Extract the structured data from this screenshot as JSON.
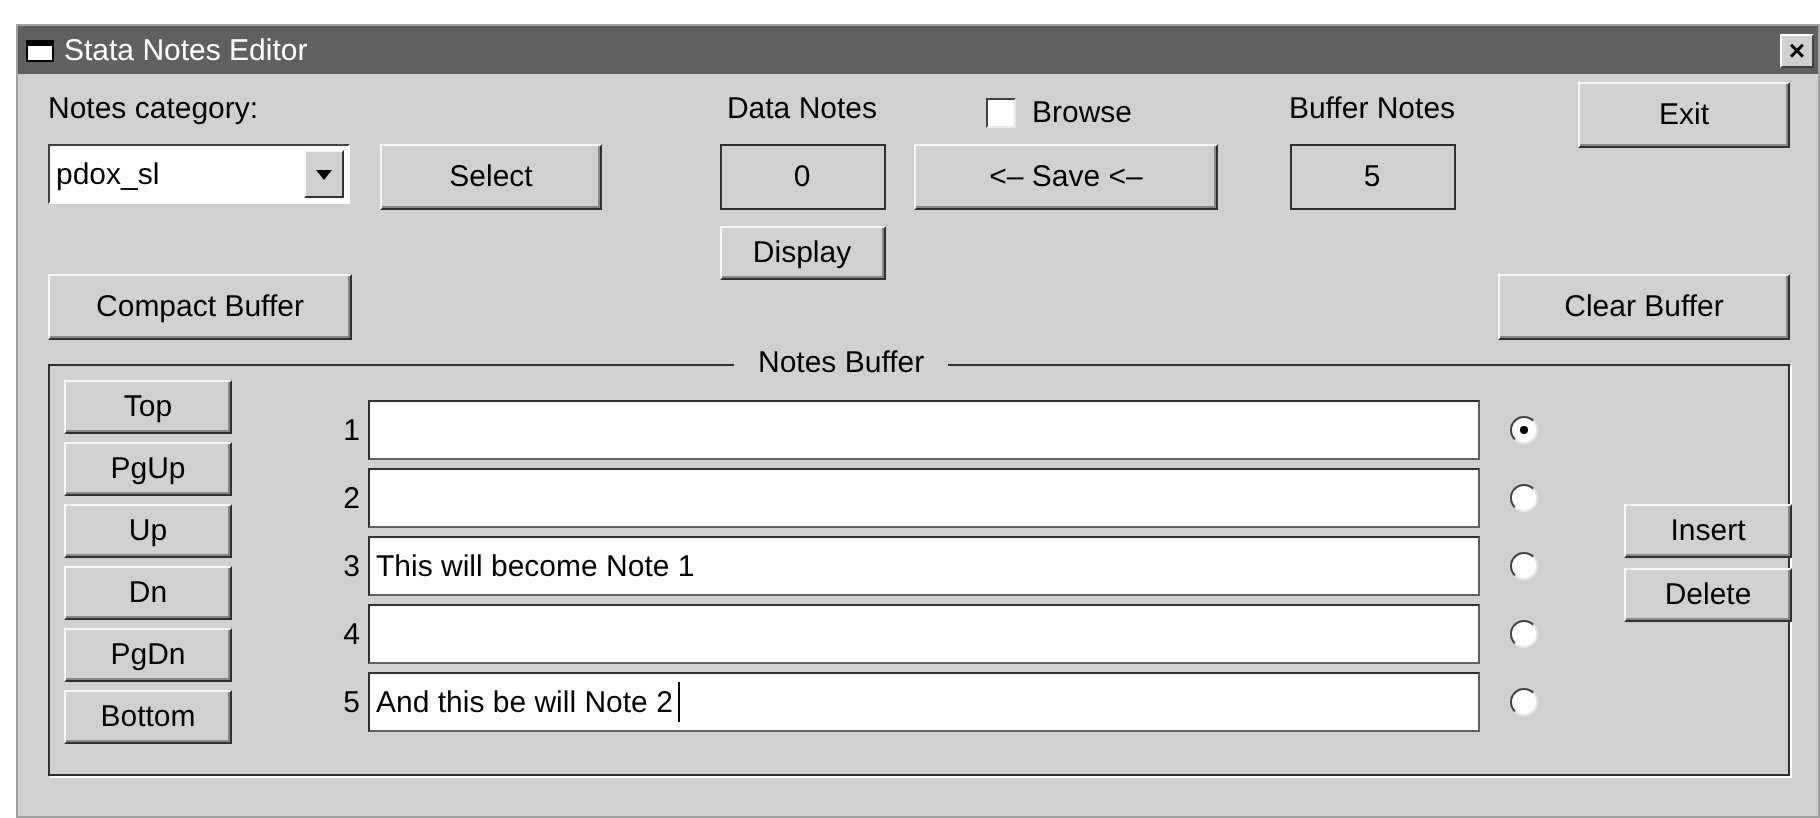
{
  "window": {
    "title": "Stata Notes Editor",
    "close": "×"
  },
  "category": {
    "label": "Notes category:",
    "value": "pdox_sl",
    "select_button": "Select"
  },
  "data_notes": {
    "label": "Data Notes",
    "count": "0",
    "display_button": "Display"
  },
  "browse": {
    "label": "Browse",
    "checked": false
  },
  "save_button": "<– Save <–",
  "buffer_notes": {
    "label": "Buffer Notes",
    "count": "5"
  },
  "exit_button": "Exit",
  "compact_button": "Compact Buffer",
  "clear_button": "Clear Buffer",
  "notes_buffer": {
    "title": "Notes Buffer",
    "nav_buttons": [
      "Top",
      "PgUp",
      "Up",
      "Dn",
      "PgDn",
      "Bottom"
    ],
    "rows": [
      {
        "number": "1",
        "text": "",
        "selected": true,
        "focused": false
      },
      {
        "number": "2",
        "text": "",
        "selected": false,
        "focused": false
      },
      {
        "number": "3",
        "text": "This will become Note 1",
        "selected": false,
        "focused": false
      },
      {
        "number": "4",
        "text": "",
        "selected": false,
        "focused": false
      },
      {
        "number": "5",
        "text": "And this be will Note 2",
        "selected": false,
        "focused": true
      }
    ],
    "insert_button": "Insert",
    "delete_button": "Delete"
  }
}
